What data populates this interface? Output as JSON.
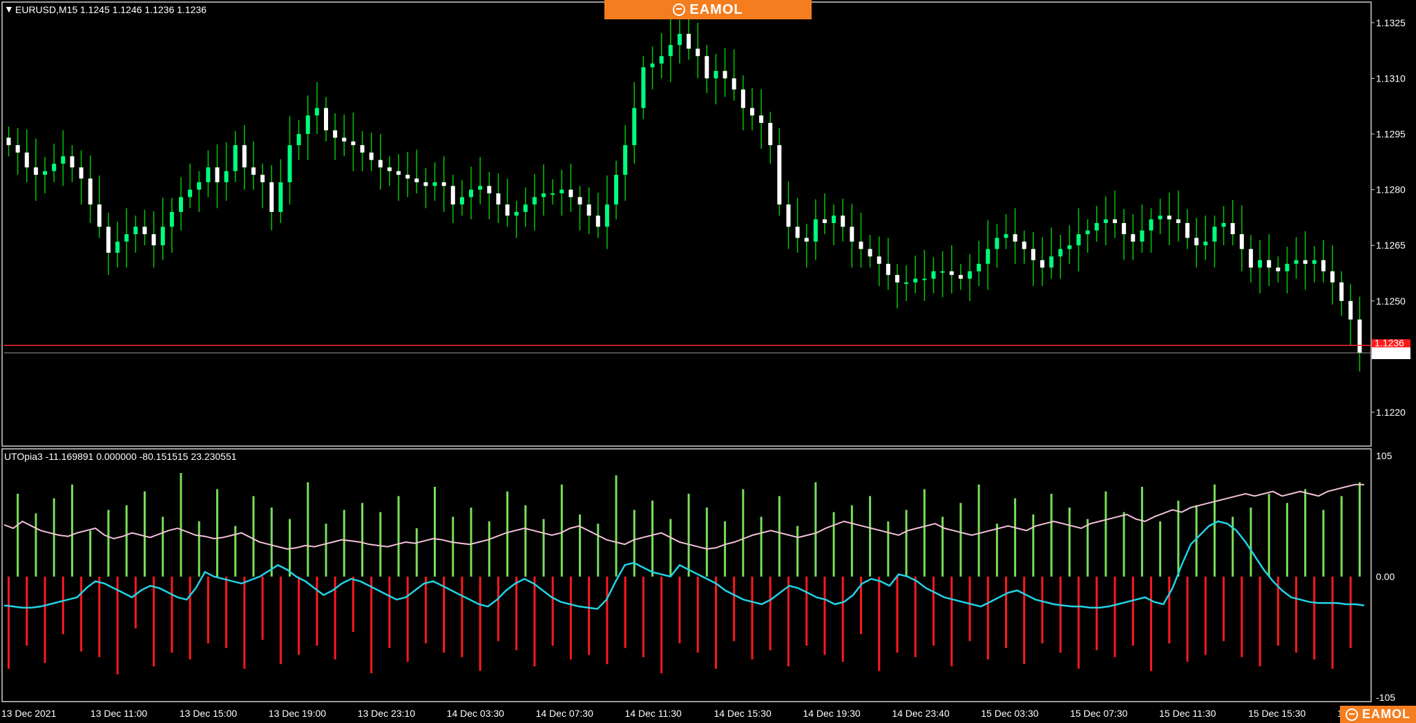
{
  "header": {
    "symbol_label": "EURUSD,M15",
    "ohlc_label": "1.1245 1.1246 1.1236 1.1236"
  },
  "brand": {
    "name": "EAMOL",
    "color": "#f47d1f"
  },
  "indicator": {
    "label": "UTOpia3 -11.169891 0.000000 -80.151515 23.230551"
  },
  "colors": {
    "bull_candle": "#00ff7f",
    "bear_candle": "#ffffff",
    "wick": "#00c800",
    "positive_bar": "#76e05a",
    "negative_bar": "#ff1a1a",
    "signal_line": "#f4c2dc",
    "cyan_line": "#22d3e6",
    "current_price_line": "#ff2a2a",
    "bid_line": "#9a9a9a",
    "frame": "#cfcfcf"
  },
  "chart_data": [
    {
      "type": "candlestick",
      "symbol": "EURUSD",
      "timeframe": "M15",
      "title": "EURUSD,M15",
      "y_ticks": [
        "1.1325",
        "1.1310",
        "1.1295",
        "1.1280",
        "1.1265",
        "1.1250",
        "1.1220"
      ],
      "ylim": [
        1.1212,
        1.133
      ],
      "current_price": "1.1236",
      "current_price_marker": "1.1238",
      "close_series": [
        1.1292,
        1.129,
        1.1286,
        1.1284,
        1.1285,
        1.1287,
        1.1289,
        1.1286,
        1.1283,
        1.1276,
        1.127,
        1.1263,
        1.1266,
        1.1268,
        1.127,
        1.1268,
        1.1265,
        1.127,
        1.1274,
        1.1278,
        1.128,
        1.1282,
        1.1286,
        1.1282,
        1.1285,
        1.1292,
        1.1286,
        1.1284,
        1.1282,
        1.1274,
        1.1282,
        1.1292,
        1.1295,
        1.13,
        1.1302,
        1.1296,
        1.1294,
        1.1293,
        1.1292,
        1.129,
        1.1288,
        1.1286,
        1.1285,
        1.1284,
        1.1283,
        1.1282,
        1.1281,
        1.1282,
        1.1281,
        1.1276,
        1.1278,
        1.128,
        1.1281,
        1.1279,
        1.1276,
        1.1273,
        1.1274,
        1.1276,
        1.1278,
        1.1279,
        1.1279,
        1.128,
        1.1278,
        1.1276,
        1.1273,
        1.127,
        1.1276,
        1.1284,
        1.1292,
        1.1302,
        1.1313,
        1.1314,
        1.1316,
        1.1319,
        1.1322,
        1.1318,
        1.1316,
        1.131,
        1.1312,
        1.131,
        1.1307,
        1.1302,
        1.13,
        1.1298,
        1.1292,
        1.1276,
        1.127,
        1.1267,
        1.1266,
        1.1272,
        1.1271,
        1.1273,
        1.127,
        1.1266,
        1.1264,
        1.1262,
        1.126,
        1.1257,
        1.1255,
        1.1255,
        1.1256,
        1.1256,
        1.1258,
        1.1258,
        1.1257,
        1.1256,
        1.1258,
        1.126,
        1.1264,
        1.1267,
        1.1268,
        1.1266,
        1.1264,
        1.1261,
        1.1259,
        1.1262,
        1.1264,
        1.1265,
        1.1268,
        1.1269,
        1.1271,
        1.1272,
        1.1271,
        1.1268,
        1.1266,
        1.1269,
        1.1272,
        1.1273,
        1.1272,
        1.1271,
        1.1267,
        1.1265,
        1.1266,
        1.127,
        1.1271,
        1.1268,
        1.1264,
        1.1259,
        1.1261,
        1.1259,
        1.1258,
        1.126,
        1.1261,
        1.126,
        1.1261,
        1.1258,
        1.1255,
        1.125,
        1.1245,
        1.1236
      ],
      "x_ticks": [
        "13 Dec 2021",
        "13 Dec 11:00",
        "13 Dec 15:00",
        "13 Dec 19:00",
        "13 Dec 23:10",
        "14 Dec 03:30",
        "14 Dec 07:30",
        "14 Dec 11:30",
        "14 Dec 15:30",
        "14 Dec 19:30",
        "14 Dec 23:40",
        "15 Dec 03:30",
        "15 Dec 07:30",
        "15 Dec 11:30",
        "15 Dec 15:30",
        "15"
      ]
    },
    {
      "type": "bar",
      "title": "UTOpia3",
      "y_ticks": [
        "105",
        "0.00",
        "-105"
      ],
      "ylim": [
        -105,
        105
      ],
      "series": [
        {
          "name": "UTOpia3 histogram",
          "kind": "bar",
          "values": [
            -80,
            72,
            -60,
            55,
            -75,
            68,
            -50,
            80,
            -65,
            40,
            -70,
            58,
            -85,
            62,
            -45,
            74,
            -78,
            52,
            -66,
            90,
            -72,
            48,
            -58,
            76,
            -62,
            44,
            -80,
            70,
            -55,
            60,
            -76,
            50,
            -68,
            82,
            -60,
            46,
            -72,
            58,
            -48,
            64,
            -84,
            56,
            -62,
            70,
            -74,
            42,
            -58,
            78,
            -66,
            52,
            -70,
            60,
            -82,
            48,
            -56,
            74,
            -64,
            62,
            -78,
            50,
            -60,
            80,
            -72,
            54,
            -68,
            46,
            -76,
            88,
            -62,
            58,
            -70,
            66,
            -84,
            50,
            -58,
            72,
            -66,
            60,
            -80,
            48,
            -56,
            76,
            -72,
            52,
            -64,
            70,
            -78,
            44,
            -60,
            82,
            -68,
            56,
            -74,
            62,
            -50,
            70,
            -82,
            48,
            -66,
            58,
            -70,
            76,
            -60,
            52,
            -78,
            64,
            -56,
            80,
            -72,
            46,
            -62,
            68,
            -76,
            54,
            -58,
            72,
            -66,
            60,
            -80,
            50,
            -64,
            74,
            -70,
            56,
            -60,
            78,
            -82,
            48,
            -58,
            66,
            -74,
            62,
            -68,
            80,
            -56,
            52,
            -70,
            60,
            -78,
            72,
            -60,
            64,
            -66,
            76,
            -72,
            58,
            -80,
            70,
            -62,
            82
          ]
        },
        {
          "name": "signal line",
          "kind": "line",
          "values": [
            45,
            42,
            48,
            44,
            40,
            38,
            36,
            35,
            38,
            40,
            42,
            36,
            33,
            35,
            38,
            36,
            34,
            37,
            40,
            42,
            39,
            36,
            35,
            33,
            34,
            36,
            38,
            34,
            30,
            28,
            26,
            24,
            25,
            27,
            26,
            28,
            30,
            32,
            31,
            30,
            28,
            27,
            26,
            28,
            30,
            29,
            31,
            33,
            32,
            30,
            29,
            28,
            30,
            32,
            35,
            38,
            40,
            42,
            40,
            38,
            36,
            38,
            42,
            44,
            40,
            36,
            32,
            30,
            28,
            32,
            34,
            36,
            38,
            34,
            30,
            28,
            26,
            24,
            25,
            28,
            30,
            33,
            36,
            38,
            40,
            38,
            36,
            34,
            36,
            38,
            42,
            45,
            48,
            46,
            44,
            42,
            40,
            38,
            36,
            40,
            42,
            44,
            46,
            42,
            40,
            38,
            36,
            38,
            40,
            42,
            44,
            42,
            40,
            44,
            46,
            48,
            46,
            44,
            42,
            46,
            48,
            50,
            52,
            54,
            50,
            48,
            52,
            55,
            58,
            56,
            60,
            62,
            64,
            66,
            68,
            70,
            72,
            70,
            72,
            74,
            70,
            72,
            74,
            72,
            70,
            74,
            76,
            78,
            80,
            80
          ]
        },
        {
          "name": "oscillator line",
          "kind": "line",
          "values": [
            -25,
            -26,
            -27,
            -27,
            -26,
            -24,
            -22,
            -20,
            -18,
            -10,
            -4,
            -6,
            -10,
            -14,
            -18,
            -12,
            -8,
            -10,
            -14,
            -18,
            -20,
            -10,
            4,
            0,
            -2,
            -4,
            -6,
            -3,
            0,
            5,
            10,
            6,
            0,
            -4,
            -10,
            -16,
            -12,
            -6,
            -2,
            -4,
            -8,
            -12,
            -16,
            -20,
            -18,
            -12,
            -6,
            -4,
            -8,
            -12,
            -16,
            -20,
            -24,
            -26,
            -20,
            -12,
            -6,
            -2,
            -6,
            -12,
            -18,
            -22,
            -24,
            -26,
            -27,
            -28,
            -20,
            -4,
            10,
            12,
            8,
            4,
            2,
            0,
            10,
            6,
            2,
            -2,
            -6,
            -12,
            -16,
            -20,
            -22,
            -24,
            -20,
            -14,
            -8,
            -10,
            -14,
            -18,
            -20,
            -24,
            -22,
            -16,
            -6,
            -2,
            -4,
            -8,
            2,
            0,
            -4,
            -10,
            -14,
            -18,
            -20,
            -22,
            -24,
            -26,
            -22,
            -18,
            -14,
            -12,
            -16,
            -20,
            -22,
            -24,
            -25,
            -26,
            -26,
            -27,
            -27,
            -26,
            -24,
            -22,
            -20,
            -18,
            -22,
            -24,
            -10,
            10,
            28,
            36,
            44,
            48,
            46,
            40,
            30,
            18,
            6,
            -4,
            -12,
            -18,
            -20,
            -22,
            -23,
            -23,
            -23,
            -24,
            -24,
            -25
          ]
        }
      ],
      "x_ticks": [
        "13 Dec 2021",
        "13 Dec 11:00",
        "13 Dec 15:00",
        "13 Dec 19:00",
        "13 Dec 23:10",
        "14 Dec 03:30",
        "14 Dec 07:30",
        "14 Dec 11:30",
        "14 Dec 15:30",
        "14 Dec 19:30",
        "14 Dec 23:40",
        "15 Dec 03:30",
        "15 Dec 07:30",
        "15 Dec 11:30",
        "15 Dec 15:30",
        "15"
      ]
    }
  ]
}
